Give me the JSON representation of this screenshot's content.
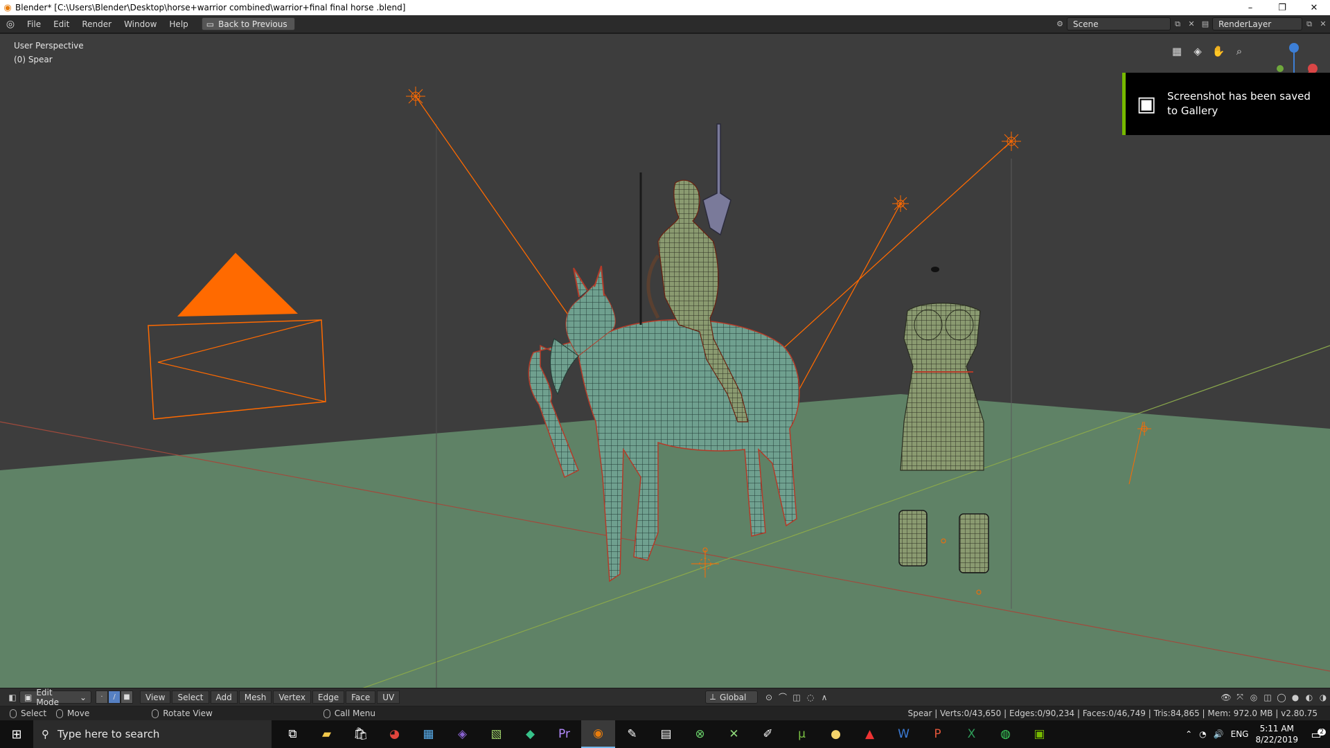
{
  "window": {
    "title": "Blender* [C:\\Users\\Blender\\Desktop\\horse+warrior combined\\warrior+final final horse .blend]",
    "minimize": "–",
    "maximize": "❐",
    "close": "✕"
  },
  "menubar": {
    "items": [
      "File",
      "Edit",
      "Render",
      "Window",
      "Help"
    ],
    "back_button": "Back to Previous",
    "scene": "Scene",
    "render_layer": "RenderLayer"
  },
  "viewport": {
    "perspective_label": "User Perspective",
    "object_label": "(0) Spear"
  },
  "notification": {
    "text": "Screenshot has been saved to Gallery"
  },
  "viewport_header": {
    "mode": "Edit Mode",
    "menus": [
      "View",
      "Select",
      "Add",
      "Mesh",
      "Vertex",
      "Edge",
      "Face",
      "UV"
    ],
    "orientation": "Global"
  },
  "statusbar": {
    "hint_select": "Select",
    "hint_move": "Move",
    "hint_rotate": "Rotate View",
    "hint_menu": "Call Menu",
    "stats": "Spear | Verts:0/43,650 | Edges:0/90,234 | Faces:0/46,749 | Tris:84,865 | Mem: 972.0 MB | v2.80.75"
  },
  "taskbar": {
    "search_placeholder": "Type here to search",
    "language": "ENG",
    "time": "5:11 AM",
    "date": "8/22/2019",
    "notification_count": "2"
  },
  "colors": {
    "accent_orange": "#ff6a00",
    "floor": "#5f8266",
    "mesh": "#6b9e8c",
    "nvidia_green": "#76b900"
  }
}
